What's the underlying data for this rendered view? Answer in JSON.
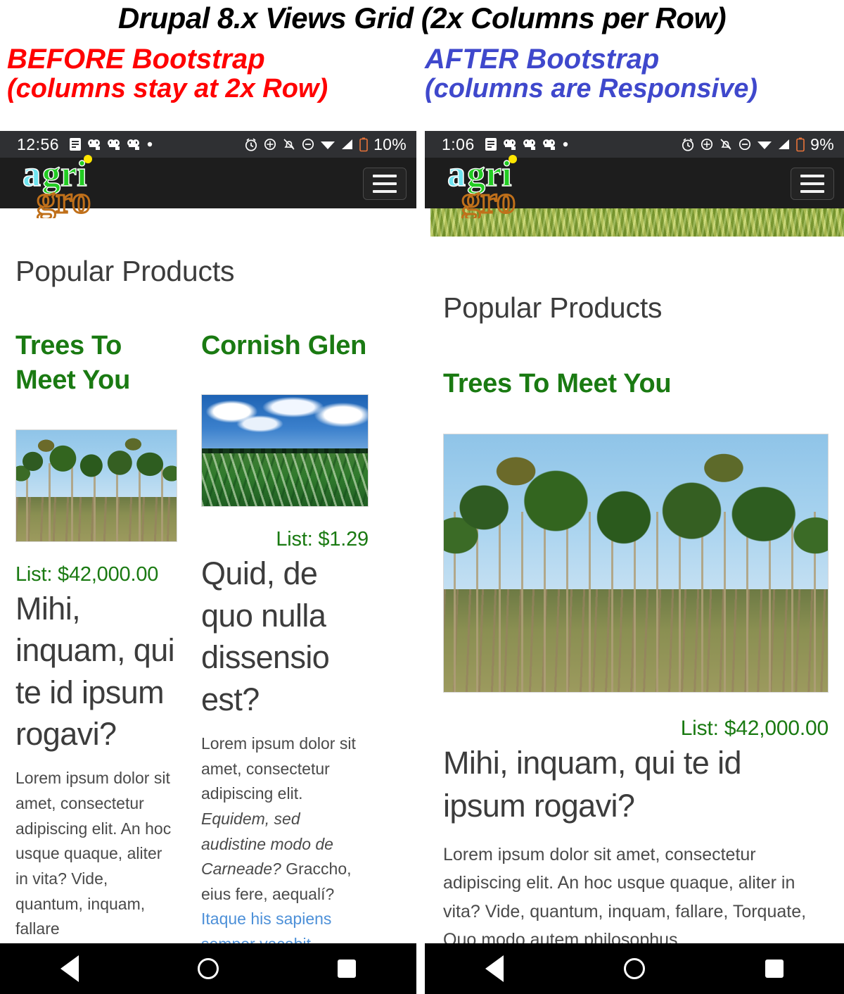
{
  "caption": {
    "title": "Drupal 8.x Views Grid (2x Columns per Row)",
    "left_line1": "BEFORE Bootstrap",
    "left_line2": "(columns stay at 2x Row)",
    "right_line1": "AFTER Bootstrap",
    "right_line2": "(columns are Responsive)",
    "left_color": "#ff0000",
    "right_color": "#3f48cc",
    "title_color": "#000000"
  },
  "left_phone": {
    "status": {
      "time": "12:56",
      "battery": "10%",
      "icons_left": [
        "notes-icon",
        "chat-icon",
        "chat-icon",
        "chat-icon",
        "dot-icon"
      ],
      "icons_right": [
        "alarm-icon",
        "location-icon",
        "bell-off-icon",
        "dnd-icon",
        "wifi-icon",
        "signal-icon",
        "battery-icon"
      ]
    },
    "site": {
      "logo_top": "agri",
      "logo_bottom": "gro",
      "menu_label": "hamburger-menu"
    },
    "section_title": "Popular Products",
    "products": [
      {
        "title": "Trees To Meet You",
        "image": "teak-plantation-photo",
        "price": "List:  $42,000.00",
        "heading": "Mihi, inquam, qui te id ipsum rogavi?",
        "body_plain_1": "Lorem ipsum dolor sit amet, consectetur adipiscing elit. An hoc usque quaque, aliter in vita? Vide, quantum, inquam, fallare"
      },
      {
        "title": "Cornish Glen",
        "image": "corn-field-photo",
        "price": "List:  $1.29",
        "heading": "Quid, de quo nulla dissensio est?",
        "body_plain_1": "Lorem ipsum dolor sit amet, consectetur adipiscing elit. ",
        "body_italic": "Equidem, sed audistine modo de Carneade?",
        "body_plain_2": " Graccho, eius fere, aequalí? ",
        "body_link": "Itaque his sapiens semper vacabit."
      }
    ],
    "navbar": {
      "back": "back-button",
      "home": "home-button",
      "recents": "recents-button"
    }
  },
  "right_phone": {
    "status": {
      "time": "1:06",
      "battery": "9%",
      "icons_left": [
        "notes-icon",
        "chat-icon",
        "chat-icon",
        "chat-icon",
        "dot-icon"
      ],
      "icons_right": [
        "alarm-icon",
        "location-icon",
        "bell-off-icon",
        "dnd-icon",
        "wifi-icon",
        "signal-icon",
        "battery-icon"
      ]
    },
    "site": {
      "logo_top": "agri",
      "logo_bottom": "gro",
      "menu_label": "hamburger-menu"
    },
    "hero": "wheat-field-banner",
    "section_title": "Popular Products",
    "products": [
      {
        "title": "Trees To Meet You",
        "image": "teak-plantation-photo",
        "price": "List:  $42,000.00",
        "heading": "Mihi, inquam, qui te id ipsum rogavi?",
        "body_plain_1": "Lorem ipsum dolor sit amet, consectetur adipiscing elit. An hoc usque quaque, aliter in vita? Vide, quantum, inquam, fallare, Torquate, Quo modo autem philosophus"
      }
    ],
    "navbar": {
      "back": "back-button",
      "home": "home-button",
      "recents": "recents-button"
    }
  },
  "colors": {
    "brand_green": "#1a7a12",
    "logo_cyan": "#6ee4f0",
    "logo_green": "#22cc22",
    "logo_orange": "#c0701a",
    "logo_dot": "#ffe600",
    "link_blue": "#4d90d8",
    "status_bg": "#2f3033",
    "header_bg": "#1d1d1d",
    "navbar_bg": "#000000"
  }
}
